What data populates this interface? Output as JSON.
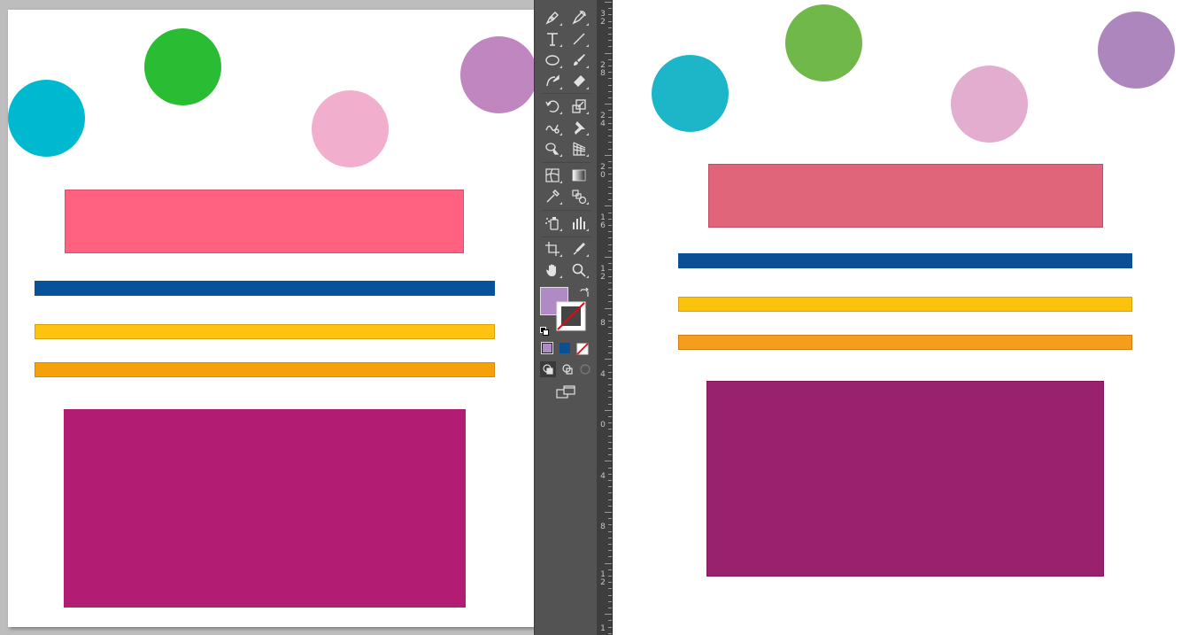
{
  "left_artboard": {
    "shapes": [
      {
        "name": "cyan-circle",
        "color": "#00b9d1"
      },
      {
        "name": "green-circle",
        "color": "#2abd34"
      },
      {
        "name": "pink-circle",
        "color": "#f2aecd"
      },
      {
        "name": "purple-circle",
        "color": "#bf86c0"
      },
      {
        "name": "pink-rectangle",
        "color": "#ff6181"
      },
      {
        "name": "blue-bar",
        "color": "#06539c"
      },
      {
        "name": "yellow-bar",
        "color": "#ffc20e"
      },
      {
        "name": "orange-bar",
        "color": "#f7a10a"
      },
      {
        "name": "magenta-rectangle",
        "color": "#b21d73"
      }
    ]
  },
  "right_canvas": {
    "shapes": [
      {
        "name": "cyan-circle",
        "color": "#1db6c9"
      },
      {
        "name": "green-circle",
        "color": "#71b84a"
      },
      {
        "name": "pink-circle",
        "color": "#e2adcf"
      },
      {
        "name": "purple-circle",
        "color": "#ad86bd"
      },
      {
        "name": "pink-rectangle",
        "color": "#e1657a"
      },
      {
        "name": "blue-bar",
        "color": "#0d4f94"
      },
      {
        "name": "yellow-bar",
        "color": "#fbc20e"
      },
      {
        "name": "orange-bar",
        "color": "#f59e1d"
      },
      {
        "name": "magenta-rectangle",
        "color": "#99216e"
      }
    ]
  },
  "toolbar": {
    "tools": [
      "pen-icon",
      "curvature-icon",
      "type-icon",
      "line-segment-icon",
      "ellipse-icon",
      "paintbrush-icon",
      "shaper-icon",
      "eraser-icon",
      "rotate-icon",
      "scale-icon",
      "warp-icon",
      "puppet-warp-icon",
      "shape-builder-icon",
      "perspective-grid-icon",
      "mesh-icon",
      "gradient-icon",
      "eyedropper-icon",
      "blend-icon",
      "symbol-sprayer-icon",
      "column-graph-icon",
      "artboard-icon",
      "slice-icon",
      "hand-icon",
      "zoom-icon"
    ],
    "fill_color": "#b08ac4",
    "stroke": "none",
    "swatches": {
      "color": "#b08ac4",
      "gradient": "#0b4f94",
      "none": "none"
    }
  },
  "ruler": {
    "labels": [
      "32",
      "28",
      "24",
      "20",
      "16",
      "12",
      "8",
      "4",
      "0",
      "4",
      "8",
      "12",
      "1"
    ]
  }
}
